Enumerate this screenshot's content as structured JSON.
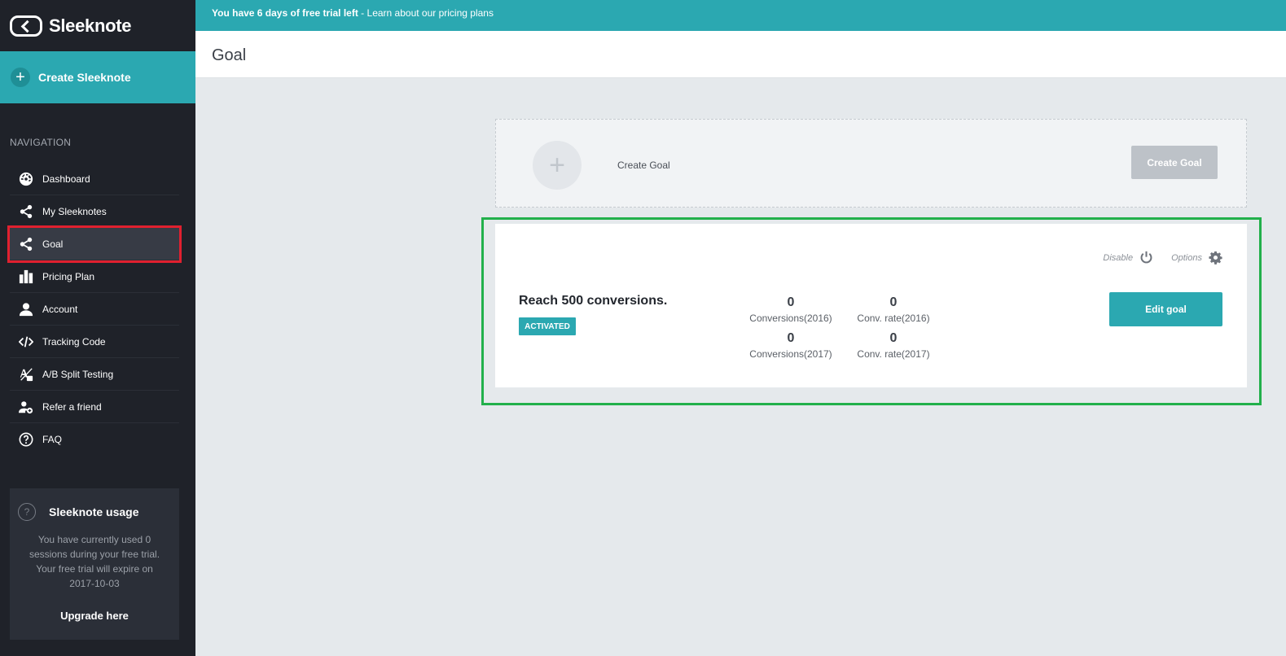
{
  "brand": {
    "name": "Sleeknote"
  },
  "sidebar": {
    "create_label": "Create Sleeknote",
    "nav_heading": "NAVIGATION",
    "items": [
      {
        "label": "Dashboard",
        "icon": "dashboard-icon"
      },
      {
        "label": "My Sleeknotes",
        "icon": "share-icon"
      },
      {
        "label": "Goal",
        "icon": "share-icon",
        "active": true
      },
      {
        "label": "Pricing Plan",
        "icon": "pricing-icon"
      },
      {
        "label": "Account",
        "icon": "user-icon"
      },
      {
        "label": "Tracking Code",
        "icon": "code-icon"
      },
      {
        "label": "A/B Split Testing",
        "icon": "ab-test-icon"
      },
      {
        "label": "Refer a friend",
        "icon": "refer-friend-icon"
      },
      {
        "label": "FAQ",
        "icon": "help-icon"
      }
    ],
    "usage": {
      "title": "Sleeknote usage",
      "help_glyph": "?",
      "text": "You have currently used 0 sessions during your free trial. Your free trial will expire on 2017-10-03",
      "link": "Upgrade here"
    }
  },
  "banner": {
    "trial_text": "You have 6 days of free trial left",
    "separator": " - ",
    "link": "Learn about our pricing plans"
  },
  "header": {
    "title": "Goal"
  },
  "create_goal": {
    "plus": "+",
    "label": "Create Goal",
    "button": "Create Goal"
  },
  "goal": {
    "title": "Reach 500 conversions.",
    "status": "ACTIVATED",
    "disable_label": "Disable",
    "options_label": "Options",
    "edit_label": "Edit goal",
    "stats": [
      {
        "value": "0",
        "label": "Conversions(2016)"
      },
      {
        "value": "0",
        "label": "Conv. rate(2016)"
      },
      {
        "value": "0",
        "label": "Conversions(2017)"
      },
      {
        "value": "0",
        "label": "Conv. rate(2017)"
      }
    ]
  },
  "colors": {
    "accent": "#2ba8b1",
    "sidebar_bg": "#1f2229",
    "active_outline": "#e0202f",
    "highlight_outline": "#22b04b"
  }
}
